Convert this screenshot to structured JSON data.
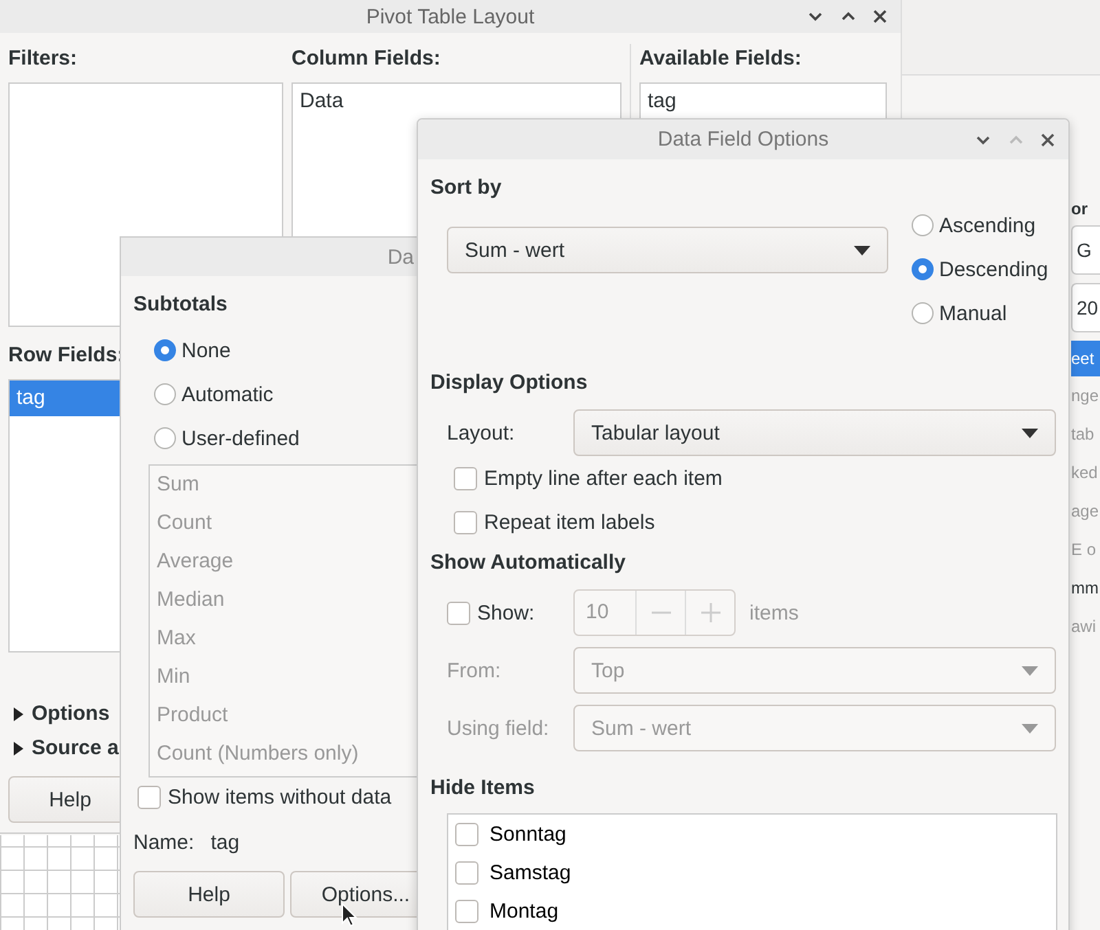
{
  "main_window": {
    "title": "Pivot Table Layout",
    "filters_label": "Filters:",
    "column_fields_label": "Column Fields:",
    "column_fields": [
      "Data"
    ],
    "available_fields_label": "Available Fields:",
    "available_fields": [
      "tag"
    ],
    "row_fields_label": "Row Fields:",
    "row_fields": [
      {
        "label": "tag",
        "selected": true
      }
    ],
    "expanders": [
      {
        "label": "Options",
        "expanded": false
      },
      {
        "label": "Source a",
        "expanded": false
      }
    ],
    "help_button": "Help"
  },
  "background_panel": {
    "heading": "or",
    "fields": [
      "G",
      "20"
    ],
    "items": [
      {
        "label": "eet",
        "selected": true,
        "disabled": false
      },
      {
        "label": "nge",
        "selected": false,
        "disabled": true
      },
      {
        "label": "tab",
        "selected": false,
        "disabled": true
      },
      {
        "label": "ked",
        "selected": false,
        "disabled": true
      },
      {
        "label": "age",
        "selected": false,
        "disabled": true
      },
      {
        "label": "E o",
        "selected": false,
        "disabled": true
      },
      {
        "label": "mm",
        "selected": false,
        "disabled": false
      },
      {
        "label": "awi",
        "selected": false,
        "disabled": true
      }
    ]
  },
  "subtotals_dialog": {
    "title": "Da",
    "subtotals_label": "Subtotals",
    "subtotal_modes": [
      {
        "label": "None",
        "selected": true
      },
      {
        "label": "Automatic",
        "selected": false
      },
      {
        "label": "User-defined",
        "selected": false
      }
    ],
    "functions_disabled": true,
    "functions": [
      "Sum",
      "Count",
      "Average",
      "Median",
      "Max",
      "Min",
      "Product",
      "Count (Numbers only)"
    ],
    "show_items_without_data": {
      "label": "Show items without data",
      "checked": false
    },
    "name_label": "Name:",
    "name_value": "tag",
    "buttons": [
      "Help",
      "Options..."
    ]
  },
  "data_field_options": {
    "title": "Data Field Options",
    "sort_by_label": "Sort by",
    "sort_field": "Sum - wert",
    "sort_orders": [
      {
        "label": "Ascending",
        "selected": false
      },
      {
        "label": "Descending",
        "selected": true
      },
      {
        "label": "Manual",
        "selected": false
      }
    ],
    "display_options_label": "Display Options",
    "layout_label": "Layout:",
    "layout_value": "Tabular layout",
    "display_checks": [
      {
        "label": "Empty line after each item",
        "checked": false
      },
      {
        "label": "Repeat item labels",
        "checked": false
      }
    ],
    "show_automatically_label": "Show Automatically",
    "show": {
      "label": "Show:",
      "checked": false
    },
    "show_count": {
      "value": "10",
      "disabled": true
    },
    "items_label": "items",
    "from": {
      "label": "From:",
      "value": "Top",
      "disabled": true
    },
    "using_field": {
      "label": "Using field:",
      "value": "Sum - wert",
      "disabled": true
    },
    "hide_items_label": "Hide Items",
    "hide_items": [
      {
        "label": "Sonntag",
        "checked": false
      },
      {
        "label": "Samstag",
        "checked": false
      },
      {
        "label": "Montag",
        "checked": false
      }
    ]
  }
}
